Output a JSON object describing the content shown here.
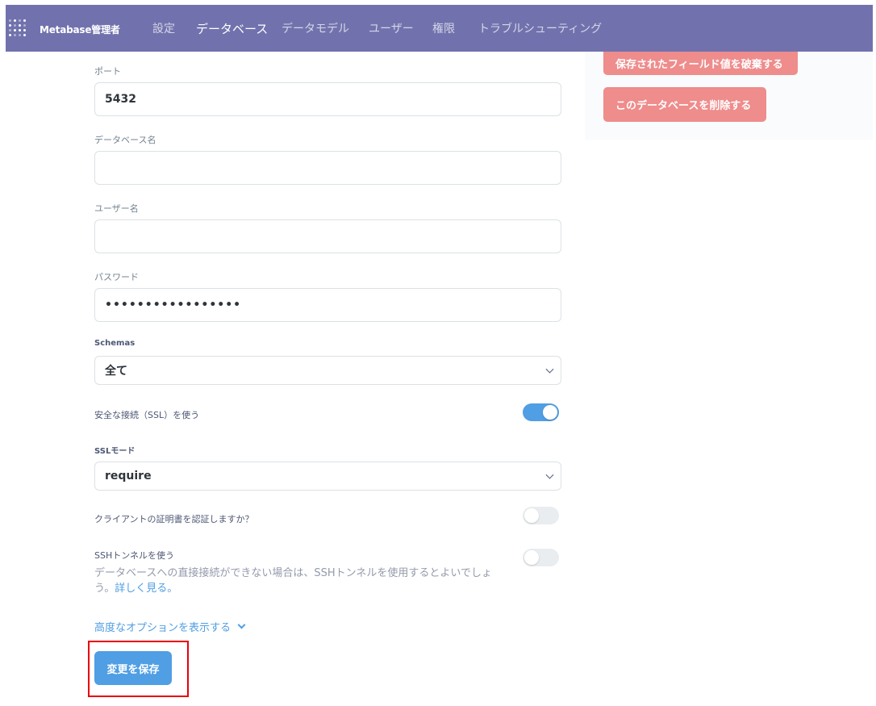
{
  "nav": {
    "brand": "Metabase管理者",
    "items": [
      "設定",
      "データベース",
      "データモデル",
      "ユーザー",
      "権限",
      "トラブルシューティング"
    ],
    "active_index": 1
  },
  "side": {
    "discard_values_label": "保存されたフィールド値を破棄する",
    "delete_db_label": "このデータベースを削除する"
  },
  "form": {
    "port": {
      "label": "ポート",
      "value": "5432"
    },
    "db_name": {
      "label": "データベース名",
      "value": ""
    },
    "username": {
      "label": "ユーザー名",
      "value": ""
    },
    "password": {
      "label": "パスワード",
      "value": "•••••••••••••••••"
    },
    "schemas": {
      "label": "Schemas",
      "value": "全て"
    },
    "ssl": {
      "label": "安全な接続（SSL）を使う",
      "enabled": true
    },
    "ssl_mode": {
      "label": "SSLモード",
      "value": "require"
    },
    "client_cert": {
      "label": "クライアントの証明書を認証しますか？",
      "enabled": false
    },
    "ssh": {
      "label": "SSHトンネルを使う",
      "enabled": false,
      "description": "データベースへの直接接続ができない場合は、SSHトンネルを使用するとよいでしょう。",
      "link": "詳しく見る。"
    },
    "advanced_label": "高度なオプションを表示する",
    "save_label": "変更を保存"
  },
  "colors": {
    "nav_bg": "#7172ad",
    "danger": "#ef8c8c",
    "brand_blue": "#509ee3",
    "highlight": "#e8000b"
  }
}
